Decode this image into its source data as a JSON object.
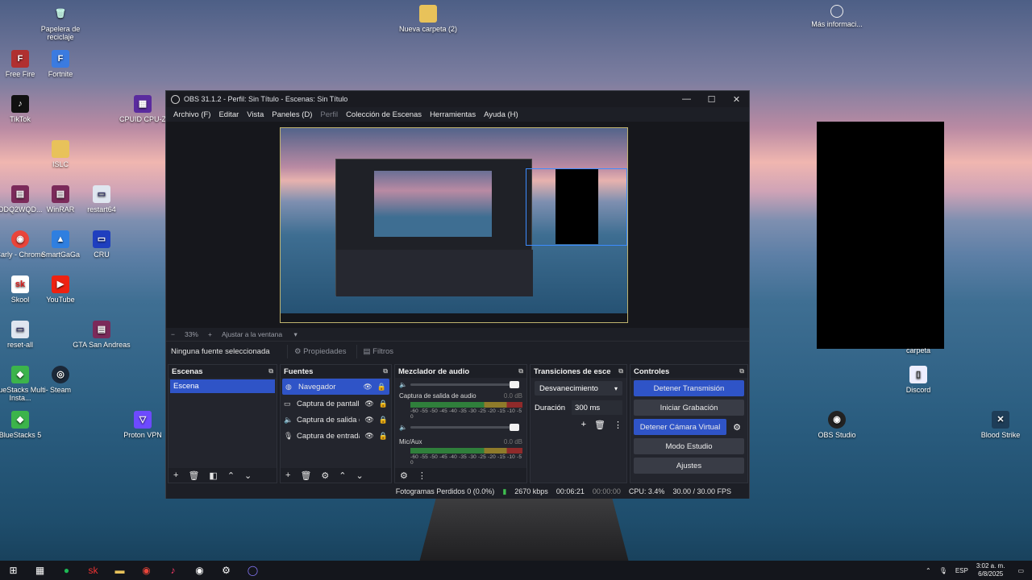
{
  "desktop": {
    "icons": [
      {
        "label": "Papelera de reciclaje",
        "icon": "recycle-bin-icon",
        "glyph": "🗑"
      },
      {
        "label": "Free Fire",
        "icon": "free-fire-icon",
        "glyph": "F"
      },
      {
        "label": "Fortnite",
        "icon": "fortnite-icon",
        "glyph": "F"
      },
      {
        "label": "TikTok",
        "icon": "tiktok-icon",
        "glyph": "♪"
      },
      {
        "label": "CPUID CPU-Z",
        "icon": "cpuz-icon",
        "glyph": "▦"
      },
      {
        "label": "ISLC",
        "icon": "folder-icon",
        "glyph": "▬"
      },
      {
        "label": "ODQ2WQD...",
        "icon": "winrar-icon",
        "glyph": "▤"
      },
      {
        "label": "WinRAR",
        "icon": "winrar-icon",
        "glyph": "▤"
      },
      {
        "label": "restart64",
        "icon": "app-icon",
        "glyph": "▭"
      },
      {
        "label": "Carly - Chrome",
        "icon": "chrome-icon",
        "glyph": "◉"
      },
      {
        "label": "SmartGaGa",
        "icon": "smartgaga-icon",
        "glyph": "▲"
      },
      {
        "label": "CRU",
        "icon": "monitor-icon",
        "glyph": "▭"
      },
      {
        "label": "Skool",
        "icon": "skool-icon",
        "glyph": "sk"
      },
      {
        "label": "YouTube",
        "icon": "youtube-icon",
        "glyph": "▶"
      },
      {
        "label": "reset-all",
        "icon": "app-icon",
        "glyph": "▭"
      },
      {
        "label": "GTA San Andreas",
        "icon": "winrar-icon",
        "glyph": "▤"
      },
      {
        "label": "BlueStacks Multi-Insta...",
        "icon": "bluestacks-icon",
        "glyph": "◆"
      },
      {
        "label": "Steam",
        "icon": "steam-icon",
        "glyph": "◎"
      },
      {
        "label": "BlueStacks 5",
        "icon": "bluestacks-icon",
        "glyph": "◆"
      },
      {
        "label": "Proton VPN",
        "icon": "protonvpn-icon",
        "glyph": "▽"
      },
      {
        "label": "Nueva carpeta (2)",
        "icon": "folder-icon",
        "glyph": "▬"
      },
      {
        "label": "Más informaci...",
        "icon": "info-icon",
        "glyph": "◌"
      },
      {
        "label": "carpeta",
        "icon": "folder-icon",
        "glyph": ""
      },
      {
        "label": "Discord",
        "icon": "file-icon",
        "glyph": "▯"
      },
      {
        "label": "OBS Studio",
        "icon": "obs-icon",
        "glyph": "◉"
      },
      {
        "label": "Blood Strike",
        "icon": "blood-strike-icon",
        "glyph": "✕"
      }
    ]
  },
  "obs": {
    "title": "OBS 31.1.2 - Perfil: Sin Título - Escenas: Sin Título",
    "menu": [
      {
        "label": "Archivo (F)",
        "disabled": false
      },
      {
        "label": "Editar",
        "disabled": false
      },
      {
        "label": "Vista",
        "disabled": false
      },
      {
        "label": "Paneles (D)",
        "disabled": false
      },
      {
        "label": "Perfil",
        "disabled": true
      },
      {
        "label": "Colección de Escenas",
        "disabled": false
      },
      {
        "label": "Herramientas",
        "disabled": false
      },
      {
        "label": "Ayuda (H)",
        "disabled": false
      }
    ],
    "zoom": {
      "minus": "−",
      "value": "33%",
      "plus": "+",
      "fit": "Ajustar a la ventana"
    },
    "props": {
      "no_source": "Ninguna fuente seleccionada",
      "properties": "Propiedades",
      "filters": "Filtros"
    },
    "scenes": {
      "title": "Escenas",
      "items": [
        "Escena"
      ]
    },
    "sources": {
      "title": "Fuentes",
      "items": [
        {
          "label": "Navegador",
          "icon": "globe-icon",
          "glyph": "◍",
          "selected": true
        },
        {
          "label": "Captura de pantalla",
          "icon": "monitor-icon",
          "glyph": "▭",
          "selected": false
        },
        {
          "label": "Captura de salida de audio",
          "icon": "speaker-icon",
          "glyph": "🔈",
          "selected": false
        },
        {
          "label": "Captura de entrada de audio",
          "icon": "microphone-icon",
          "glyph": "🎙",
          "selected": false
        }
      ]
    },
    "mixer": {
      "title": "Mezclador de audio",
      "channels": [
        {
          "name": "Captura de salida de audio",
          "db": "0.0 dB"
        },
        {
          "name": "Mic/Aux",
          "db": "0.0 dB"
        }
      ],
      "scale": "-60 -55 -50 -45 -40 -35 -30 -25 -20 -15 -10 -5 0"
    },
    "transitions": {
      "title": "Transiciones de escena",
      "selected": "Desvanecimiento",
      "duration_label": "Duración",
      "duration": "300 ms"
    },
    "controls": {
      "title": "Controles",
      "buttons": [
        {
          "label": "Detener Transmisión",
          "active": true
        },
        {
          "label": "Iniciar Grabación",
          "active": false
        },
        {
          "label": "Detener Cámara Virtual",
          "active": true
        },
        {
          "label": "Modo Estudio",
          "active": false
        },
        {
          "label": "Ajustes",
          "active": false
        }
      ]
    },
    "status": {
      "dropped": "Fotogramas Perdidos 0 (0.0%)",
      "bitrate": "2670 kbps",
      "stream_time": "00:06:21",
      "rec_time": "00:00:00",
      "cpu": "CPU: 3.4%",
      "fps": "30.00 / 30.00 FPS"
    }
  },
  "taskbar": {
    "lang": "ESP",
    "time": "3:02 a. m.",
    "date": "6/8/2025"
  }
}
